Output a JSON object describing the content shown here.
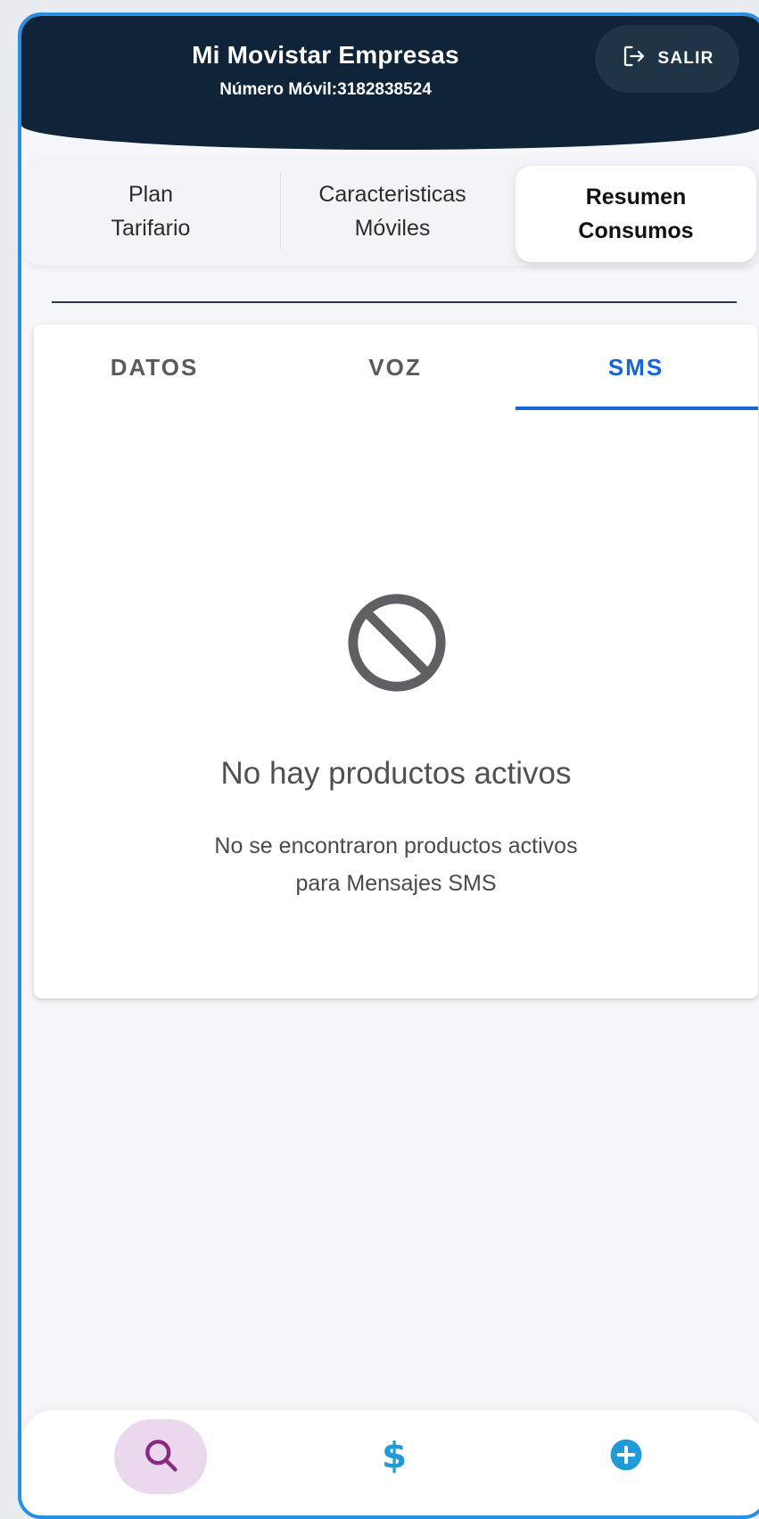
{
  "header": {
    "title": "Mi Movistar Empresas",
    "subtitle": "Número Móvil:3182838524",
    "logout_label": "SALIR",
    "logout_icon": "logout-icon"
  },
  "segment_tabs": [
    {
      "label": "Plan\nTarifario",
      "selected": false
    },
    {
      "label": "Caracteristicas\nMóviles",
      "selected": false
    },
    {
      "label": "Resumen\nConsumos",
      "selected": true
    }
  ],
  "sub_tabs": [
    {
      "label": "DATOS",
      "selected": false
    },
    {
      "label": "VOZ",
      "selected": false
    },
    {
      "label": "SMS",
      "selected": true
    }
  ],
  "empty_state": {
    "icon": "block-icon",
    "title": "No hay productos activos",
    "description": "No se encontraron productos activos\npara Mensajes SMS"
  },
  "bottom_nav": [
    {
      "icon": "search-icon",
      "active": true
    },
    {
      "icon": "dollar-icon",
      "active": false
    },
    {
      "icon": "add-circle-icon",
      "active": false
    }
  ],
  "colors": {
    "header_bg": "#0f2438",
    "accent_blue": "#1565d8",
    "frame_border": "#2a8fe0",
    "nav_active_bg": "#ecd8ee",
    "search_icon": "#8b2a80",
    "dollar_icon": "#1f9bd8",
    "add_icon": "#1f9bd8"
  }
}
